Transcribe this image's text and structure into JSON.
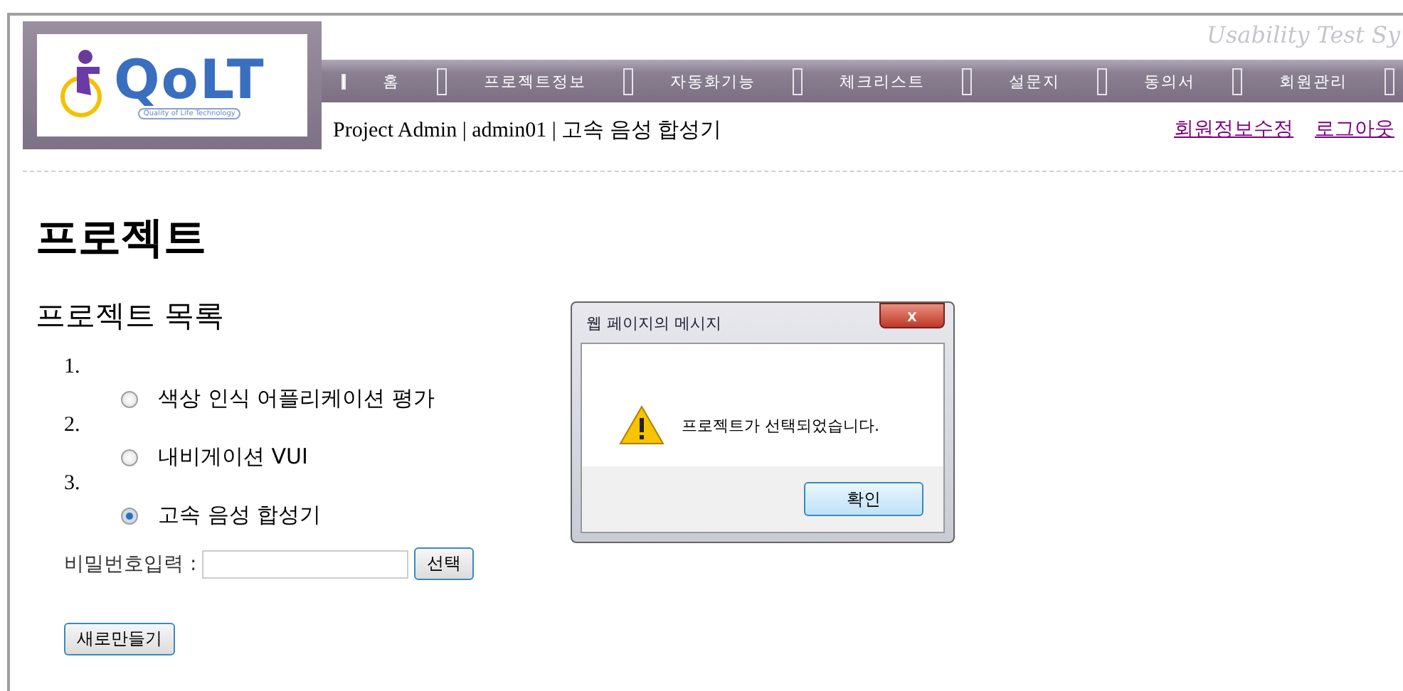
{
  "logo": {
    "name": "QoLT",
    "tagline": "Quality of Life Technology"
  },
  "system_title": "Usability Test Sy",
  "nav": [
    "홈",
    "프로젝트정보",
    "자동화기능",
    "체크리스트",
    "설문지",
    "동의서",
    "회원관리"
  ],
  "user_line": "Project Admin | admin01 | 고속 음성 합성기",
  "user_links": [
    "회원정보수정",
    "로그아웃"
  ],
  "heading": "프로젝트",
  "subheading": "프로젝트 목록",
  "projects": [
    {
      "number": "1.",
      "name": "색상 인식 어플리케이션 평가",
      "selected": false
    },
    {
      "number": "2.",
      "name": "내비게이션 VUI",
      "selected": false
    },
    {
      "number": "3.",
      "name": "고속 음성 합성기",
      "selected": true
    }
  ],
  "password": {
    "label": "비밀번호입력 :",
    "button": "선택"
  },
  "new_button": "새로만들기",
  "dialog": {
    "title": "웹 페이지의 메시지",
    "close": "x",
    "message": "프로젝트가 선택되었습니다.",
    "ok": "확인"
  }
}
